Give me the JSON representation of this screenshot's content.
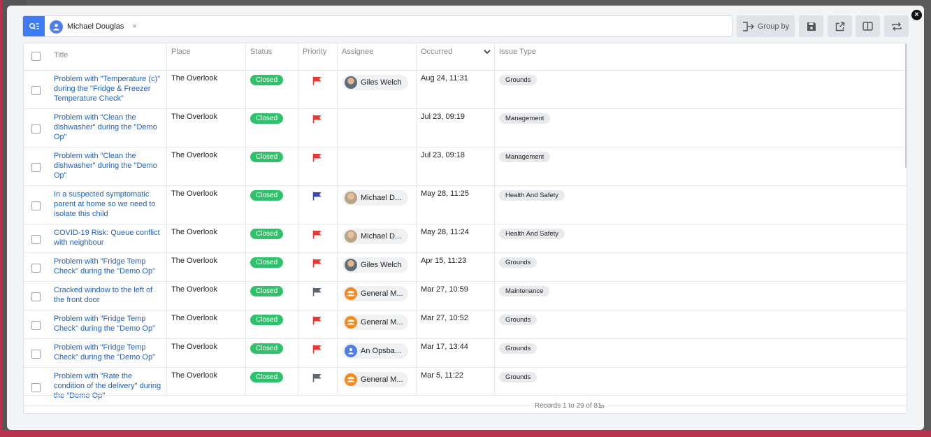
{
  "search": {
    "chip_label": "Michael Douglas",
    "chip_remove": "×"
  },
  "toolbar": {
    "group_by_label": "Group by",
    "close_label": "×"
  },
  "table": {
    "columns": [
      "Title",
      "Place",
      "Status",
      "Priority",
      "Assignee",
      "Occurred",
      "Issue Type"
    ],
    "rows": [
      {
        "title": "Problem with \"Temperature (c)\" during the \"Fridge & Freezer Temperature Check\"",
        "place": "The Overlook",
        "status": "Closed",
        "priority": "red",
        "assignee": "Giles Welch",
        "assignee_avatar": "photo",
        "occurred": "Aug 24, 11:31",
        "issue_type": "Grounds"
      },
      {
        "title": "Problem with \"Clean the dishwasher\" during the \"Demo Op\"",
        "place": "The Overlook",
        "status": "Closed",
        "priority": "red",
        "assignee": "",
        "assignee_avatar": "",
        "occurred": "Jul 23, 09:19",
        "issue_type": "Management"
      },
      {
        "title": "Problem with \"Clean the dishwasher\" during the \"Demo Op\"",
        "place": "The Overlook",
        "status": "Closed",
        "priority": "red",
        "assignee": "",
        "assignee_avatar": "",
        "occurred": "Jul 23, 09:18",
        "issue_type": "Management"
      },
      {
        "title": "In a suspected symptomatic parent at home so we need to isolate this child",
        "place": "The Overlook",
        "status": "Closed",
        "priority": "blue",
        "assignee": "Michael D...",
        "assignee_avatar": "photo2",
        "occurred": "May 28, 11:25",
        "issue_type": "Health And Safety"
      },
      {
        "title": "COVID-19 Risk: Queue conflict with neighbour",
        "place": "The Overlook",
        "status": "Closed",
        "priority": "red",
        "assignee": "Michael D...",
        "assignee_avatar": "photo2",
        "occurred": "May 28, 11:24",
        "issue_type": "Health And Safety"
      },
      {
        "title": "Problem with \"Fridge Temp Check\" during the \"Demo Op\"",
        "place": "The Overlook",
        "status": "Closed",
        "priority": "red",
        "assignee": "Giles Welch",
        "assignee_avatar": "photo",
        "occurred": "Apr 15, 11:23",
        "issue_type": "Grounds"
      },
      {
        "title": "Cracked window to the left of the front door",
        "place": "The Overlook",
        "status": "Closed",
        "priority": "grey",
        "assignee": "General M...",
        "assignee_avatar": "group",
        "occurred": "Mar 27, 10:59",
        "issue_type": "Maintenance"
      },
      {
        "title": "Problem with \"Fridge Temp Check\" during the \"Demo Op\"",
        "place": "The Overlook",
        "status": "Closed",
        "priority": "red",
        "assignee": "General M...",
        "assignee_avatar": "group",
        "occurred": "Mar 27, 10:52",
        "issue_type": "Grounds"
      },
      {
        "title": "Problem with \"Fridge Temp Check\" during the \"Demo Op\"",
        "place": "The Overlook",
        "status": "Closed",
        "priority": "red",
        "assignee": "An Opsba...",
        "assignee_avatar": "user",
        "occurred": "Mar 17, 13:44",
        "issue_type": "Grounds"
      },
      {
        "title": "Problem with \"Rate the condition of the delivery\" during the \"Demo Op\"",
        "place": "The Overlook",
        "status": "Closed",
        "priority": "grey",
        "assignee": "General M...",
        "assignee_avatar": "group",
        "occurred": "Mar 5, 11:22",
        "issue_type": "Grounds"
      }
    ]
  },
  "footer": {
    "records_text": "Records 1 to 29 of 81"
  },
  "colors": {
    "accent": "#3d7cf5",
    "status_closed": "#2ec26a",
    "link": "#1f5fc4",
    "flag_red": "#e53935",
    "flag_blue": "#3949ab",
    "flag_grey": "#5f6670"
  }
}
